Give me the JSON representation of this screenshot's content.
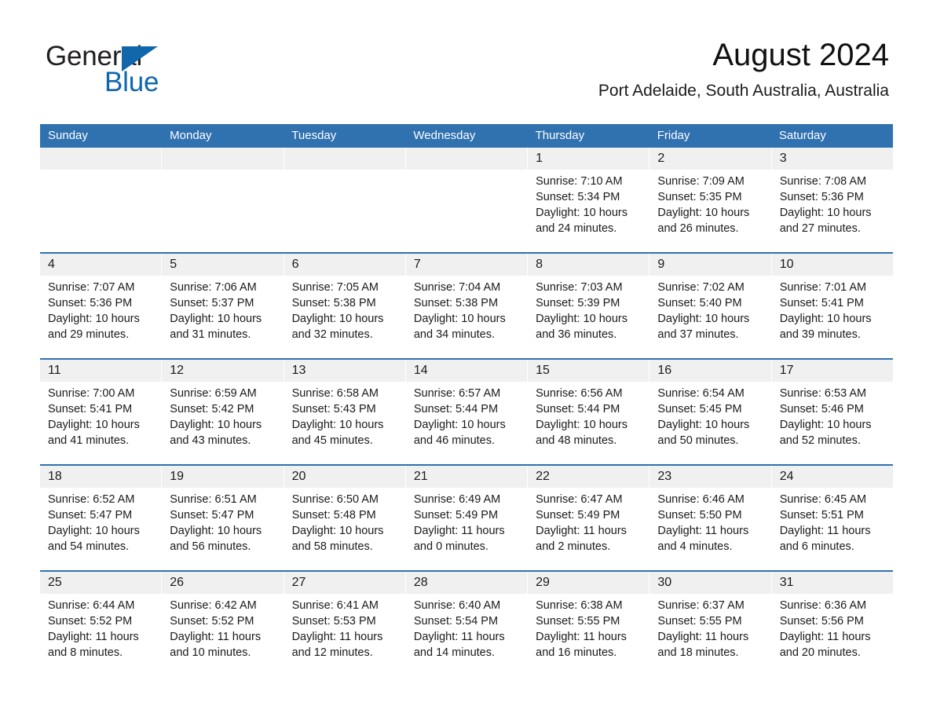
{
  "logo": {
    "word_one": "General",
    "word_two": "Blue",
    "triangle_icon": "triangle-icon",
    "brand_blue": "#1067ac"
  },
  "header": {
    "month_title": "August 2024",
    "location": "Port Adelaide, South Australia, Australia"
  },
  "theme": {
    "header_blue": "#3071b0",
    "day_band_gray": "#f0f0f0",
    "background": "#ffffff",
    "text": "#1a1a1a"
  },
  "weekdays": [
    "Sunday",
    "Monday",
    "Tuesday",
    "Wednesday",
    "Thursday",
    "Friday",
    "Saturday"
  ],
  "labels": {
    "sunrise_prefix": "Sunrise:",
    "sunset_prefix": "Sunset:",
    "daylight_prefix": "Daylight:"
  },
  "weeks": [
    [
      {
        "day": "",
        "empty": true
      },
      {
        "day": "",
        "empty": true
      },
      {
        "day": "",
        "empty": true
      },
      {
        "day": "",
        "empty": true
      },
      {
        "day": "1",
        "sunrise": "Sunrise: 7:10 AM",
        "sunset": "Sunset: 5:34 PM",
        "daylight": "Daylight: 10 hours and 24 minutes."
      },
      {
        "day": "2",
        "sunrise": "Sunrise: 7:09 AM",
        "sunset": "Sunset: 5:35 PM",
        "daylight": "Daylight: 10 hours and 26 minutes."
      },
      {
        "day": "3",
        "sunrise": "Sunrise: 7:08 AM",
        "sunset": "Sunset: 5:36 PM",
        "daylight": "Daylight: 10 hours and 27 minutes."
      }
    ],
    [
      {
        "day": "4",
        "sunrise": "Sunrise: 7:07 AM",
        "sunset": "Sunset: 5:36 PM",
        "daylight": "Daylight: 10 hours and 29 minutes."
      },
      {
        "day": "5",
        "sunrise": "Sunrise: 7:06 AM",
        "sunset": "Sunset: 5:37 PM",
        "daylight": "Daylight: 10 hours and 31 minutes."
      },
      {
        "day": "6",
        "sunrise": "Sunrise: 7:05 AM",
        "sunset": "Sunset: 5:38 PM",
        "daylight": "Daylight: 10 hours and 32 minutes."
      },
      {
        "day": "7",
        "sunrise": "Sunrise: 7:04 AM",
        "sunset": "Sunset: 5:38 PM",
        "daylight": "Daylight: 10 hours and 34 minutes."
      },
      {
        "day": "8",
        "sunrise": "Sunrise: 7:03 AM",
        "sunset": "Sunset: 5:39 PM",
        "daylight": "Daylight: 10 hours and 36 minutes."
      },
      {
        "day": "9",
        "sunrise": "Sunrise: 7:02 AM",
        "sunset": "Sunset: 5:40 PM",
        "daylight": "Daylight: 10 hours and 37 minutes."
      },
      {
        "day": "10",
        "sunrise": "Sunrise: 7:01 AM",
        "sunset": "Sunset: 5:41 PM",
        "daylight": "Daylight: 10 hours and 39 minutes."
      }
    ],
    [
      {
        "day": "11",
        "sunrise": "Sunrise: 7:00 AM",
        "sunset": "Sunset: 5:41 PM",
        "daylight": "Daylight: 10 hours and 41 minutes."
      },
      {
        "day": "12",
        "sunrise": "Sunrise: 6:59 AM",
        "sunset": "Sunset: 5:42 PM",
        "daylight": "Daylight: 10 hours and 43 minutes."
      },
      {
        "day": "13",
        "sunrise": "Sunrise: 6:58 AM",
        "sunset": "Sunset: 5:43 PM",
        "daylight": "Daylight: 10 hours and 45 minutes."
      },
      {
        "day": "14",
        "sunrise": "Sunrise: 6:57 AM",
        "sunset": "Sunset: 5:44 PM",
        "daylight": "Daylight: 10 hours and 46 minutes."
      },
      {
        "day": "15",
        "sunrise": "Sunrise: 6:56 AM",
        "sunset": "Sunset: 5:44 PM",
        "daylight": "Daylight: 10 hours and 48 minutes."
      },
      {
        "day": "16",
        "sunrise": "Sunrise: 6:54 AM",
        "sunset": "Sunset: 5:45 PM",
        "daylight": "Daylight: 10 hours and 50 minutes."
      },
      {
        "day": "17",
        "sunrise": "Sunrise: 6:53 AM",
        "sunset": "Sunset: 5:46 PM",
        "daylight": "Daylight: 10 hours and 52 minutes."
      }
    ],
    [
      {
        "day": "18",
        "sunrise": "Sunrise: 6:52 AM",
        "sunset": "Sunset: 5:47 PM",
        "daylight": "Daylight: 10 hours and 54 minutes."
      },
      {
        "day": "19",
        "sunrise": "Sunrise: 6:51 AM",
        "sunset": "Sunset: 5:47 PM",
        "daylight": "Daylight: 10 hours and 56 minutes."
      },
      {
        "day": "20",
        "sunrise": "Sunrise: 6:50 AM",
        "sunset": "Sunset: 5:48 PM",
        "daylight": "Daylight: 10 hours and 58 minutes."
      },
      {
        "day": "21",
        "sunrise": "Sunrise: 6:49 AM",
        "sunset": "Sunset: 5:49 PM",
        "daylight": "Daylight: 11 hours and 0 minutes."
      },
      {
        "day": "22",
        "sunrise": "Sunrise: 6:47 AM",
        "sunset": "Sunset: 5:49 PM",
        "daylight": "Daylight: 11 hours and 2 minutes."
      },
      {
        "day": "23",
        "sunrise": "Sunrise: 6:46 AM",
        "sunset": "Sunset: 5:50 PM",
        "daylight": "Daylight: 11 hours and 4 minutes."
      },
      {
        "day": "24",
        "sunrise": "Sunrise: 6:45 AM",
        "sunset": "Sunset: 5:51 PM",
        "daylight": "Daylight: 11 hours and 6 minutes."
      }
    ],
    [
      {
        "day": "25",
        "sunrise": "Sunrise: 6:44 AM",
        "sunset": "Sunset: 5:52 PM",
        "daylight": "Daylight: 11 hours and 8 minutes."
      },
      {
        "day": "26",
        "sunrise": "Sunrise: 6:42 AM",
        "sunset": "Sunset: 5:52 PM",
        "daylight": "Daylight: 11 hours and 10 minutes."
      },
      {
        "day": "27",
        "sunrise": "Sunrise: 6:41 AM",
        "sunset": "Sunset: 5:53 PM",
        "daylight": "Daylight: 11 hours and 12 minutes."
      },
      {
        "day": "28",
        "sunrise": "Sunrise: 6:40 AM",
        "sunset": "Sunset: 5:54 PM",
        "daylight": "Daylight: 11 hours and 14 minutes."
      },
      {
        "day": "29",
        "sunrise": "Sunrise: 6:38 AM",
        "sunset": "Sunset: 5:55 PM",
        "daylight": "Daylight: 11 hours and 16 minutes."
      },
      {
        "day": "30",
        "sunrise": "Sunrise: 6:37 AM",
        "sunset": "Sunset: 5:55 PM",
        "daylight": "Daylight: 11 hours and 18 minutes."
      },
      {
        "day": "31",
        "sunrise": "Sunrise: 6:36 AM",
        "sunset": "Sunset: 5:56 PM",
        "daylight": "Daylight: 11 hours and 20 minutes."
      }
    ]
  ]
}
